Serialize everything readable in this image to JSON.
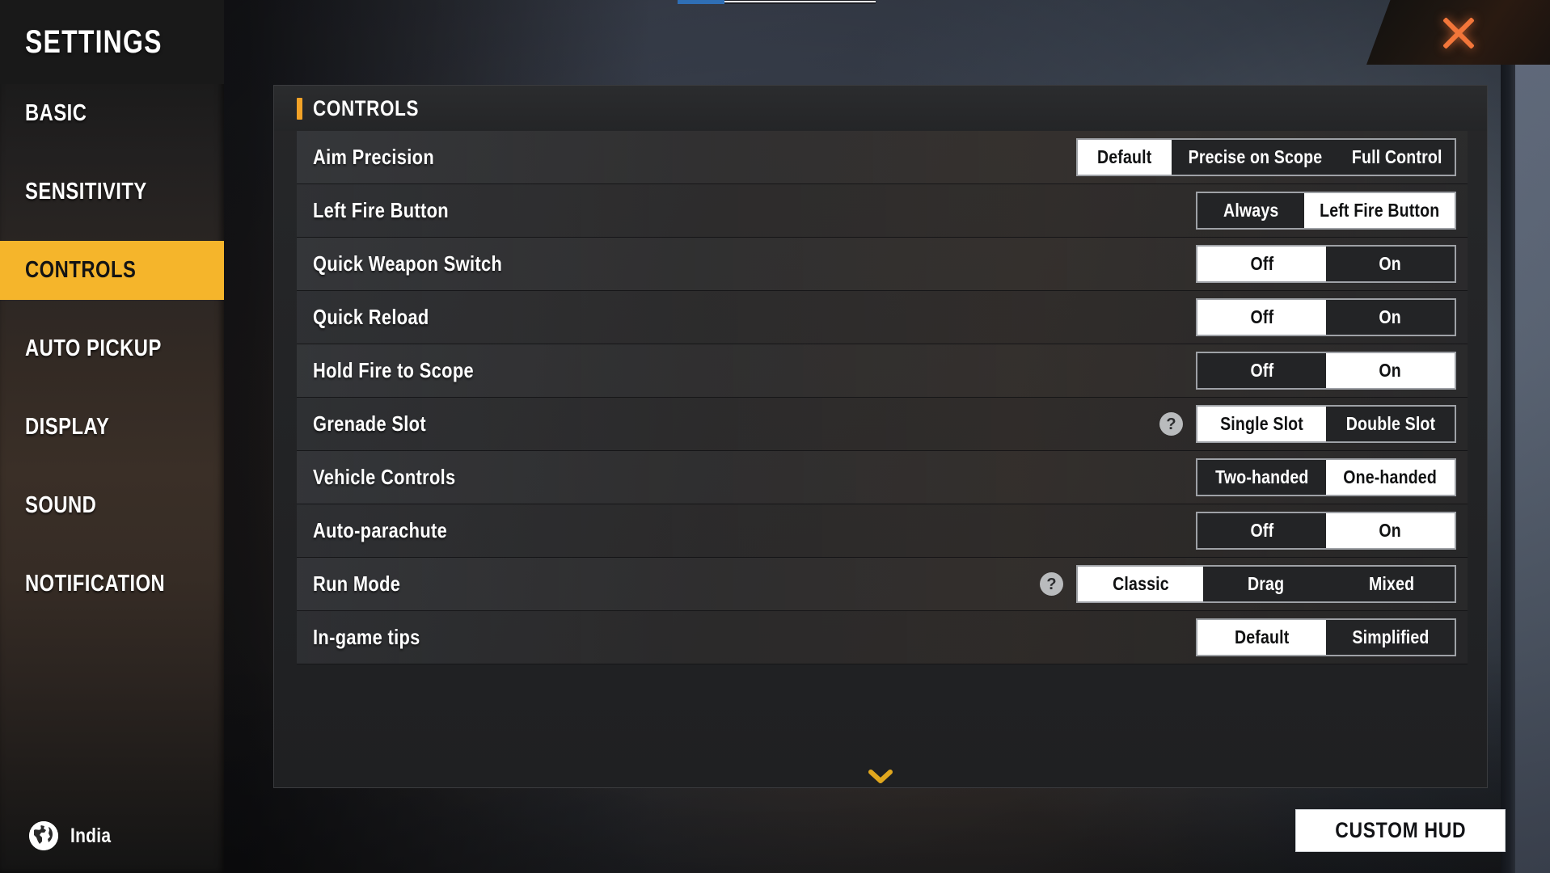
{
  "sidebar": {
    "title": "SETTINGS",
    "items": [
      {
        "label": "BASIC",
        "active": false
      },
      {
        "label": "SENSITIVITY",
        "active": false
      },
      {
        "label": "CONTROLS",
        "active": true
      },
      {
        "label": "AUTO PICKUP",
        "active": false
      },
      {
        "label": "DISPLAY",
        "active": false
      },
      {
        "label": "SOUND",
        "active": false
      },
      {
        "label": "NOTIFICATION",
        "active": false
      }
    ],
    "region": {
      "icon": "globe-icon",
      "label": "India"
    }
  },
  "window": {
    "close_icon": "close-icon",
    "accent_color": "#f5b52b",
    "close_color": "#f3763a"
  },
  "panel": {
    "title": "CONTROLS",
    "scroll_indicator_icon": "chevron-down-icon",
    "rows": [
      {
        "label": "Aim Precision",
        "help": false,
        "options": [
          "Default",
          "Precise on Scope",
          "Full Control"
        ],
        "selected": 0
      },
      {
        "label": "Left Fire Button",
        "help": false,
        "options": [
          "Always",
          "Left Fire Button"
        ],
        "selected": 1
      },
      {
        "label": "Quick Weapon Switch",
        "help": false,
        "options": [
          "Off",
          "On"
        ],
        "selected": 0
      },
      {
        "label": "Quick Reload",
        "help": false,
        "options": [
          "Off",
          "On"
        ],
        "selected": 0
      },
      {
        "label": "Hold Fire to Scope",
        "help": false,
        "options": [
          "Off",
          "On"
        ],
        "selected": 1
      },
      {
        "label": "Grenade Slot",
        "help": true,
        "options": [
          "Single Slot",
          "Double Slot"
        ],
        "selected": 0
      },
      {
        "label": "Vehicle Controls",
        "help": false,
        "options": [
          "Two-handed",
          "One-handed"
        ],
        "selected": 1
      },
      {
        "label": "Auto-parachute",
        "help": false,
        "options": [
          "Off",
          "On"
        ],
        "selected": 1
      },
      {
        "label": "Run Mode",
        "help": true,
        "options": [
          "Classic",
          "Drag",
          "Mixed"
        ],
        "selected": 0
      },
      {
        "label": "In-game tips",
        "help": false,
        "options": [
          "Default",
          "Simplified"
        ],
        "selected": 0
      }
    ]
  },
  "footer": {
    "custom_hud_label": "CUSTOM HUD"
  }
}
